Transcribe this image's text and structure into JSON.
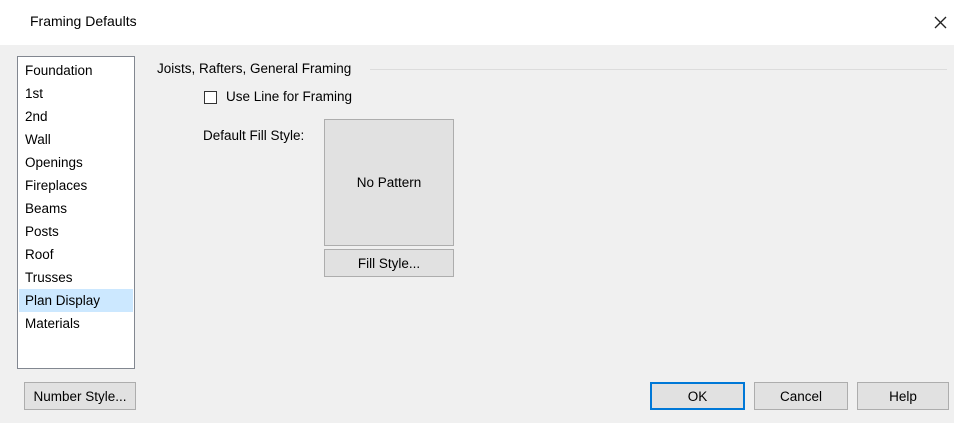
{
  "window": {
    "title": "Framing Defaults",
    "close_icon": "close-icon"
  },
  "category_list": {
    "items": [
      {
        "label": "Foundation",
        "selected": false
      },
      {
        "label": "1st",
        "selected": false
      },
      {
        "label": "2nd",
        "selected": false
      },
      {
        "label": "Wall",
        "selected": false
      },
      {
        "label": "Openings",
        "selected": false
      },
      {
        "label": "Fireplaces",
        "selected": false
      },
      {
        "label": "Beams",
        "selected": false
      },
      {
        "label": "Posts",
        "selected": false
      },
      {
        "label": "Roof",
        "selected": false
      },
      {
        "label": "Trusses",
        "selected": false
      },
      {
        "label": "Plan Display",
        "selected": true
      },
      {
        "label": "Materials",
        "selected": false
      }
    ],
    "selected_color": "#cce8ff"
  },
  "panel": {
    "group_title": "Joists, Rafters, General Framing",
    "use_line_checkbox": {
      "label": "Use Line for Framing",
      "checked": false
    },
    "fill_style_label": "Default Fill Style:",
    "pattern_preview_text": "No Pattern",
    "fill_style_button": "Fill Style..."
  },
  "footer": {
    "number_style_button": "Number Style...",
    "ok_button": "OK",
    "cancel_button": "Cancel",
    "help_button": "Help",
    "default_button_border_color": "#0078d7"
  }
}
